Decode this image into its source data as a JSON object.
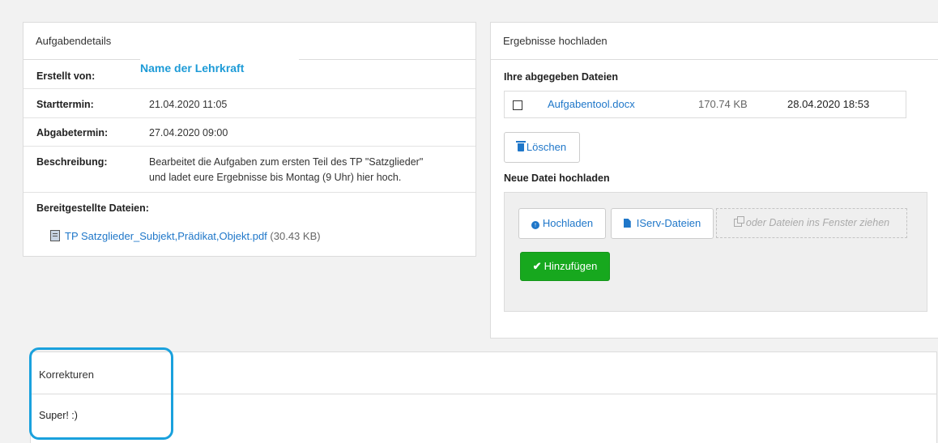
{
  "details": {
    "heading": "Aufgabendetails",
    "rows": [
      {
        "label": "Erstellt von:",
        "value": "Name der Lehrkraft"
      },
      {
        "label": "Starttermin:",
        "value": "21.04.2020 11:05"
      },
      {
        "label": "Abgabetermin:",
        "value": "27.04.2020 09:00"
      },
      {
        "label": "Beschreibung:",
        "value_line1": "Bearbeitet die Aufgaben zum ersten Teil des TP \"Satzglieder\"",
        "value_line2": "und ladet eure Ergebnisse bis Montag (9 Uhr) hier hoch."
      },
      {
        "label": "Bereitgestellte Dateien:"
      }
    ],
    "file": {
      "name": "TP Satzglieder_Subjekt,Prädikat,Objekt.pdf",
      "size": "(30.43 KB)",
      "icon": "pdf-file-icon"
    }
  },
  "upload": {
    "heading": "Ergebnisse hochladen",
    "submitted_heading": "Ihre abgegeben Dateien",
    "submitted_file": {
      "name": "Aufgabentool.docx",
      "size": "170.74 KB",
      "date": "28.04.2020 18:53"
    },
    "delete_label": "Löschen",
    "new_heading": "Neue Datei hochladen",
    "upload_label": "Hochladen",
    "iserv_label": "IServ-Dateien",
    "drop_text": "oder Dateien ins Fenster ziehen",
    "add_label": "Hinzufügen"
  },
  "corrections": {
    "heading": "Korrekturen",
    "text": "Super! :)"
  },
  "colors": {
    "link": "#1f77c9",
    "add_button": "#17a81e",
    "highlight": "#1aa1dd",
    "teacher_name": "#1d9bd7"
  }
}
